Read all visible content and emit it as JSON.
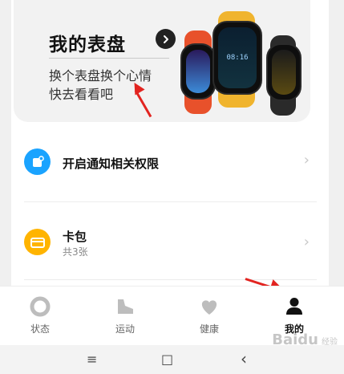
{
  "banner": {
    "title": "我的表盘",
    "subtitle_line1": "换个表盘换个心情",
    "subtitle_line2": "快去看看吧",
    "watch_time": "08:16"
  },
  "rows": [
    {
      "label": "开启通知相关权限",
      "sublabel": "",
      "icon": "notification-icon",
      "color": "#1aa3ff"
    },
    {
      "label": "卡包",
      "sublabel": "共3张",
      "icon": "wallet-icon",
      "color": "#ffb400"
    }
  ],
  "nav": {
    "items": [
      {
        "label": "状态",
        "icon": "status-ring-icon"
      },
      {
        "label": "运动",
        "icon": "shoe-icon"
      },
      {
        "label": "健康",
        "icon": "heart-icon"
      },
      {
        "label": "我的",
        "icon": "person-icon",
        "active": true
      }
    ]
  },
  "system_bar": {
    "menu": "≡",
    "home": "□",
    "back": "‹"
  },
  "watermark": {
    "text": "Baidu",
    "sub": "经验"
  }
}
